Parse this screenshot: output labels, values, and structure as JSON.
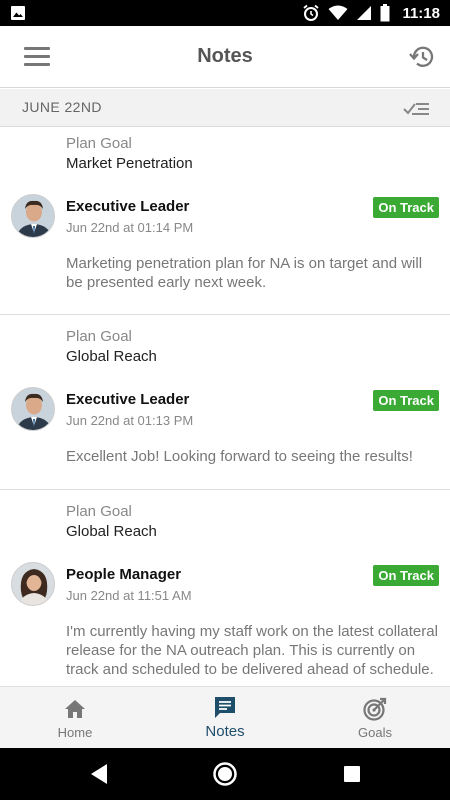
{
  "status_bar": {
    "time": "11:18"
  },
  "app_bar": {
    "title": "Notes"
  },
  "date_header": {
    "date": "JUNE 22ND"
  },
  "notes": [
    {
      "goal_label": "Plan Goal",
      "goal_name": "Market Penetration",
      "author": "Executive Leader",
      "status": "On Track",
      "timestamp": "Jun 22nd at 01:14 PM",
      "body": "Marketing penetration plan for NA is on target and will be presented early next week."
    },
    {
      "goal_label": "Plan Goal",
      "goal_name": "Global Reach",
      "author": "Executive Leader",
      "status": "On Track",
      "timestamp": "Jun 22nd at 01:13 PM",
      "body": "Excellent Job! Looking forward to seeing the results!"
    },
    {
      "goal_label": "Plan Goal",
      "goal_name": "Global Reach",
      "author": "People Manager",
      "status": "On Track",
      "timestamp": "Jun 22nd at 11:51 AM",
      "body": "I'm currently having my staff work on the latest collateral release for the NA outreach plan. This is currently on track and scheduled to be delivered ahead of schedule."
    }
  ],
  "bottom_nav": {
    "home": "Home",
    "notes": "Notes",
    "goals": "Goals"
  },
  "colors": {
    "status_green": "#3aaa35",
    "active_nav": "#1f4e6b",
    "title_gray": "#555555"
  }
}
